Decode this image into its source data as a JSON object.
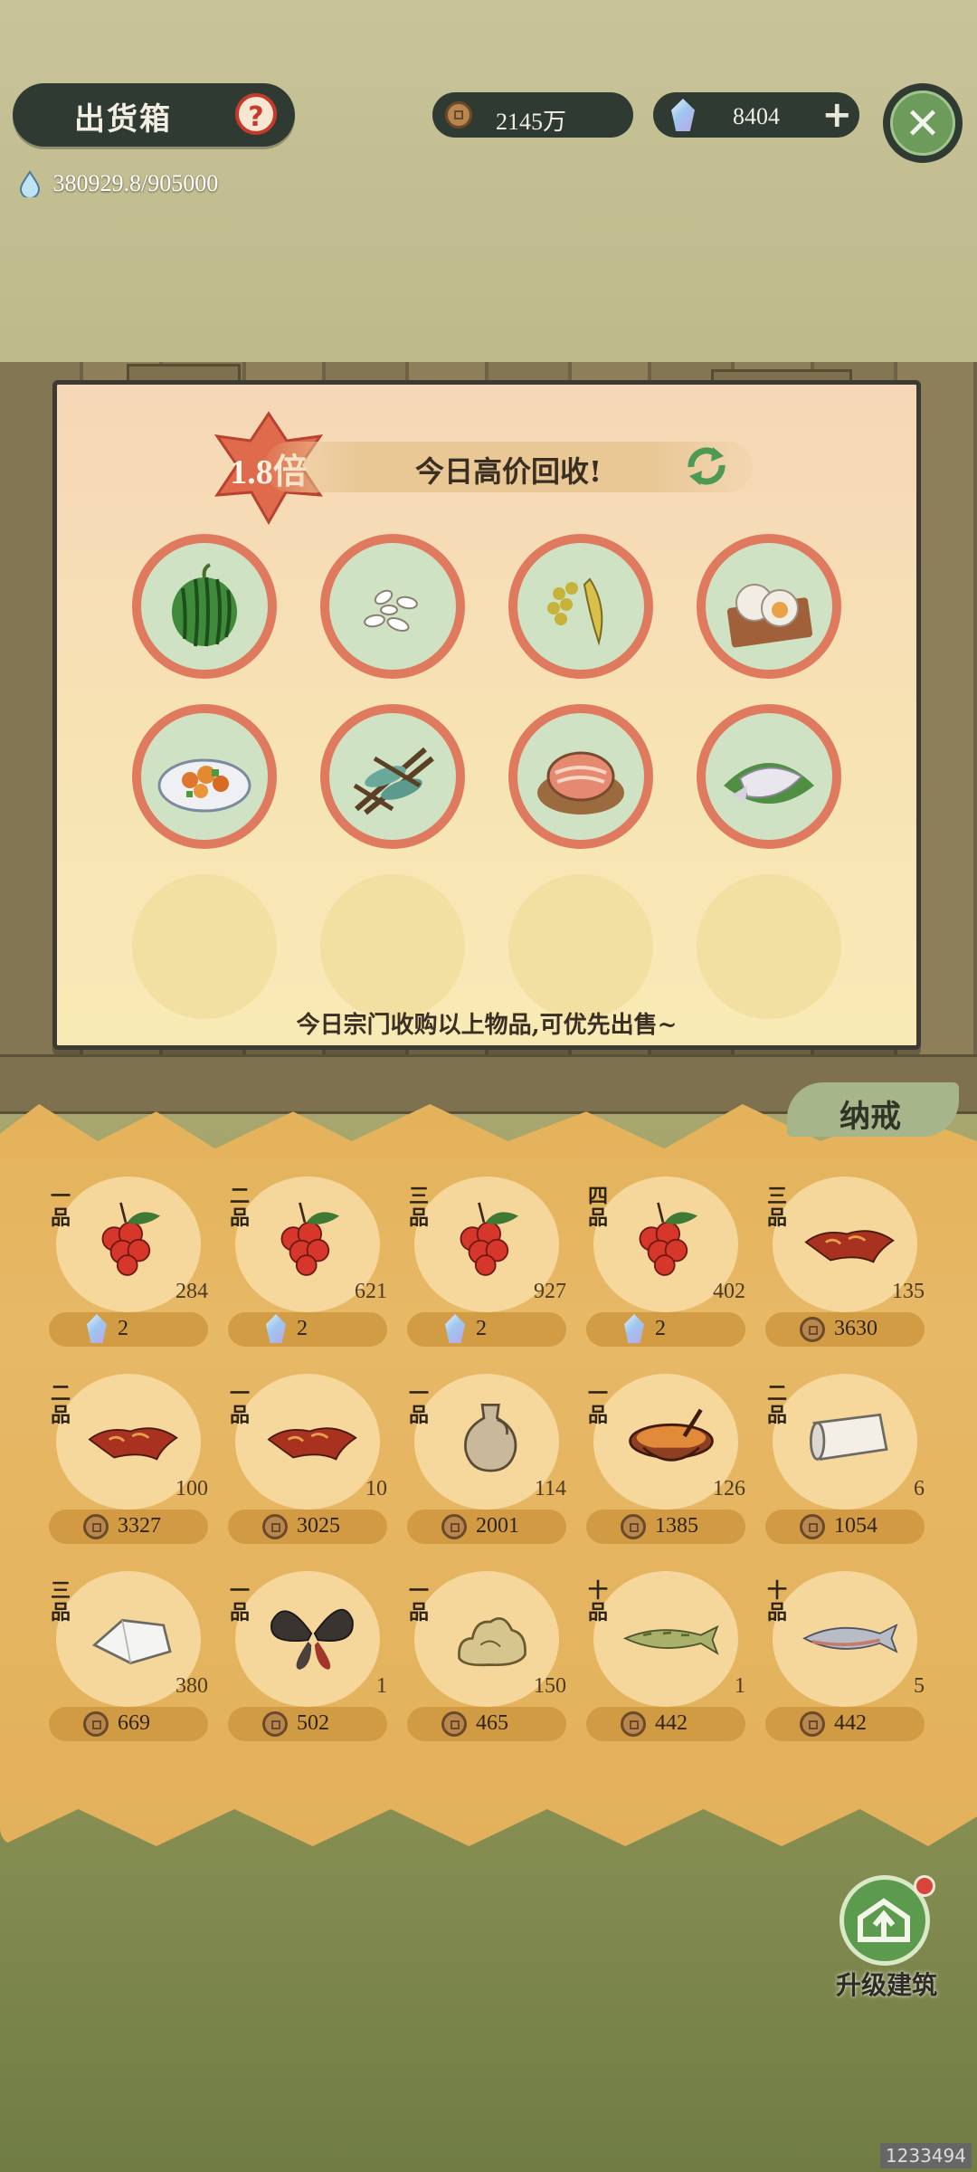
{
  "header": {
    "title": "出货箱",
    "help_label": "?",
    "water": "380929.8/905000",
    "coins": "2145万",
    "gems": "8404",
    "add_label": "+",
    "close_label": "✕"
  },
  "board": {
    "multiplier": "1.8倍",
    "banner": "今日高价回收!",
    "note": "今日宗门收购以上物品,可优先出售~",
    "items": [
      {
        "icon": "watermelon-icon"
      },
      {
        "icon": "rice-grains-icon"
      },
      {
        "icon": "soybeans-icon"
      },
      {
        "icon": "scallop-dish-icon"
      },
      {
        "icon": "stir-fry-dish-icon"
      },
      {
        "icon": "grilled-fish-rack-icon"
      },
      {
        "icon": "salmon-cut-icon"
      },
      {
        "icon": "fish-on-leaf-icon"
      }
    ]
  },
  "inventory": {
    "tab_label": "纳戒",
    "items": [
      {
        "grade": "一品",
        "icon": "red-berries-icon",
        "count": "284",
        "price": "2",
        "currency": "gem"
      },
      {
        "grade": "二品",
        "icon": "red-berries-icon",
        "count": "621",
        "price": "2",
        "currency": "gem"
      },
      {
        "grade": "三品",
        "icon": "red-berries-icon",
        "count": "927",
        "price": "2",
        "currency": "gem"
      },
      {
        "grade": "四品",
        "icon": "red-berries-icon",
        "count": "402",
        "price": "2",
        "currency": "gem"
      },
      {
        "grade": "三品",
        "icon": "beast-hide-icon",
        "count": "135",
        "price": "3630",
        "currency": "coin"
      },
      {
        "grade": "二品",
        "icon": "beast-hide-icon",
        "count": "100",
        "price": "3327",
        "currency": "coin"
      },
      {
        "grade": "一品",
        "icon": "beast-hide-icon",
        "count": "10",
        "price": "3025",
        "currency": "coin"
      },
      {
        "grade": "一品",
        "icon": "clay-jar-icon",
        "count": "114",
        "price": "2001",
        "currency": "coin"
      },
      {
        "grade": "一品",
        "icon": "soup-pot-icon",
        "count": "126",
        "price": "1385",
        "currency": "coin"
      },
      {
        "grade": "二品",
        "icon": "paper-roll-icon",
        "count": "6",
        "price": "1054",
        "currency": "coin"
      },
      {
        "grade": "三品",
        "icon": "white-cloth-icon",
        "count": "380",
        "price": "669",
        "currency": "coin"
      },
      {
        "grade": "一品",
        "icon": "butterfly-icon",
        "count": "1",
        "price": "502",
        "currency": "coin"
      },
      {
        "grade": "一品",
        "icon": "ore-pile-icon",
        "count": "150",
        "price": "465",
        "currency": "coin"
      },
      {
        "grade": "十品",
        "icon": "pike-fish-icon",
        "count": "1",
        "price": "442",
        "currency": "coin"
      },
      {
        "grade": "十品",
        "icon": "salmon-fish-icon",
        "count": "5",
        "price": "442",
        "currency": "coin"
      }
    ]
  },
  "upgrade": {
    "label": "升级建筑"
  },
  "watermark": "1233494",
  "colors": {
    "accent_red": "#e07a5e",
    "dark_pill": "#2f3a33",
    "close_green": "#6d9b5c",
    "straw": "#e4b25a"
  }
}
